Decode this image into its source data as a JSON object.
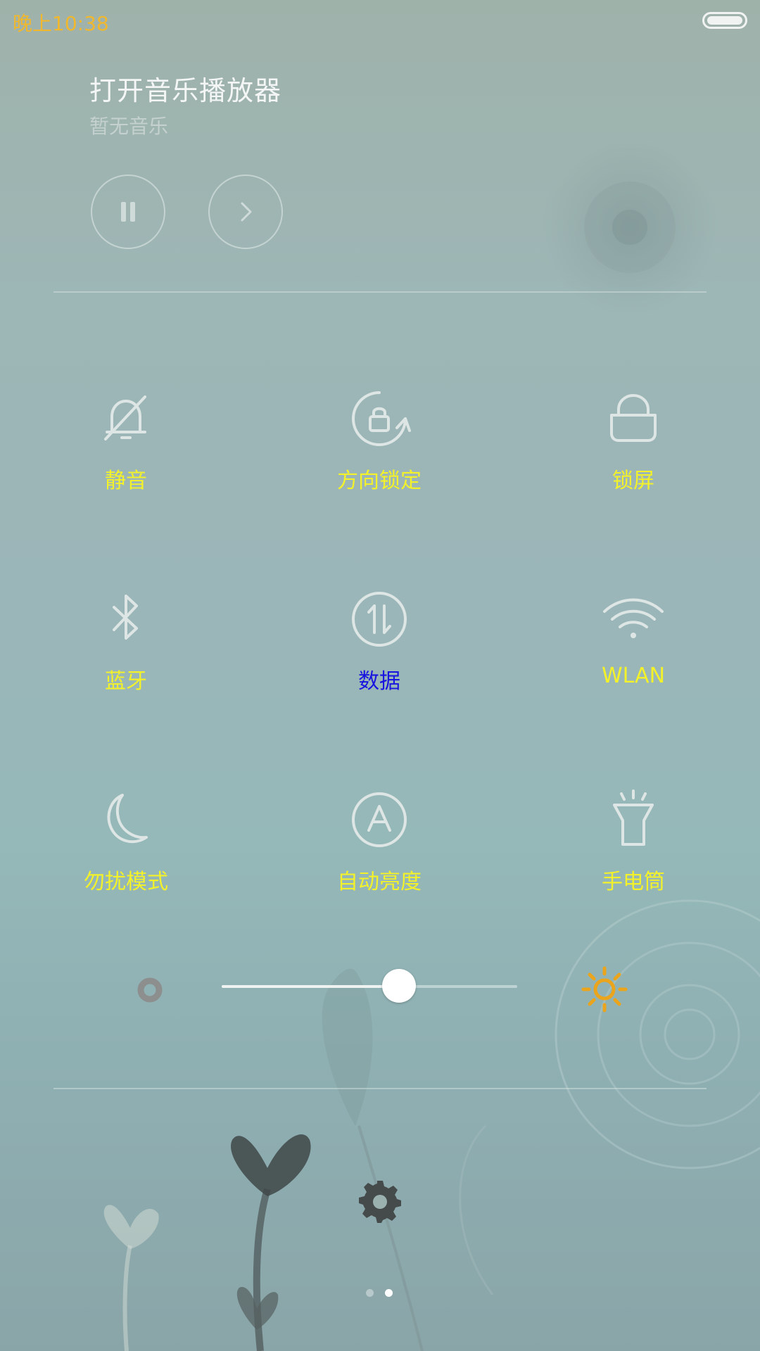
{
  "status_bar": {
    "time": "晚上10:38"
  },
  "music": {
    "title": "打开音乐播放器",
    "subtitle": "暂无音乐"
  },
  "toggles": [
    {
      "label": "静音",
      "icon": "bell-off-icon",
      "active": false
    },
    {
      "label": "方向锁定",
      "icon": "rotation-lock-icon",
      "active": false
    },
    {
      "label": "锁屏",
      "icon": "lock-icon",
      "active": false
    },
    {
      "label": "蓝牙",
      "icon": "bluetooth-icon",
      "active": false
    },
    {
      "label": "数据",
      "icon": "mobile-data-icon",
      "active": true
    },
    {
      "label": "WLAN",
      "icon": "wifi-icon",
      "active": false
    },
    {
      "label": "勿扰模式",
      "icon": "moon-icon",
      "active": false
    },
    {
      "label": "自动亮度",
      "icon": "auto-brightness-icon",
      "active": false
    },
    {
      "label": "手电筒",
      "icon": "flashlight-icon",
      "active": false
    }
  ],
  "brightness": {
    "level": 0.6
  },
  "pager": {
    "pages": 2,
    "current": 2
  },
  "colors": {
    "label": "#f3f22a",
    "label_active": "#1a14e0",
    "time": "#f1b82e",
    "sun": "#eaa51d"
  }
}
